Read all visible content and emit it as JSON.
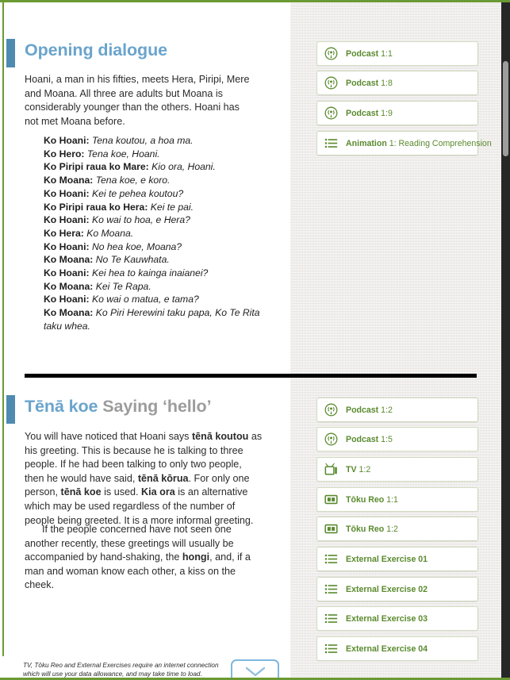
{
  "theme": {
    "accent_green": "#6a9a33",
    "link_green": "#5a8a2e",
    "heading_blue": "#6aa4cc",
    "heading_grey": "#9c9c9c",
    "tab_blue": "#4f8ab0",
    "button_border": "#cdd8bd"
  },
  "sections": [
    {
      "heading_main": "Opening dialogue",
      "heading_sub": "",
      "intro": "Hoani, a man in his fifties, meets Hera, Piripi, Mere and Moana. All three are adults but Moana is considerably younger than the others. Hoani has not met Moana before.",
      "dialogue": [
        {
          "speaker": "Ko Hoani:",
          "line": "Tena koutou, a hoa ma."
        },
        {
          "speaker": "Ko Hero:",
          "line": "Tena koe, Hoani."
        },
        {
          "speaker": "Ko Piripi raua ko Mare:",
          "line": "Kio ora, Hoani."
        },
        {
          "speaker": "Ko Moana:",
          "line": "Tena koe, e koro."
        },
        {
          "speaker": "Ko Hoani:",
          "line": "Kei te pehea koutou?"
        },
        {
          "speaker": "Ko Piripi raua ko Hera:",
          "line": "Kei te pai."
        },
        {
          "speaker": "Ko Hoani:",
          "line": "Ko wai to hoa, e Hera?"
        },
        {
          "speaker": "Ko Hera:",
          "line": "Ko Moana."
        },
        {
          "speaker": "Ko Hoani:",
          "line": "No hea koe, Moana?"
        },
        {
          "speaker": "Ko Moana:",
          "line": "No Te Kauwhata."
        },
        {
          "speaker": "Ko Hoani:",
          "line": "Kei hea to kainga inaianei?"
        },
        {
          "speaker": "Ko Moana:",
          "line": "Kei Te Rapa."
        },
        {
          "speaker": "Ko Hoani:",
          "line": "Ko wai o matua, e tama?"
        },
        {
          "speaker": "Ko Moana:",
          "line": "Ko Piri Herewini taku papa, Ko Te Rita taku whea."
        }
      ],
      "media": [
        {
          "icon": "podcast-icon",
          "label_strong": "Podcast",
          "label_rest": " 1:1"
        },
        {
          "icon": "podcast-icon",
          "label_strong": "Podcast",
          "label_rest": " 1:8"
        },
        {
          "icon": "podcast-icon",
          "label_strong": "Podcast",
          "label_rest": " 1:9"
        },
        {
          "icon": "list-icon",
          "label_strong": "Animation",
          "label_rest": " 1: Reading Comprehension"
        }
      ]
    },
    {
      "heading_main": "Tēnā koe",
      "heading_sub": " Saying ‘hello’",
      "paragraph_1_html": "You will have noticed that Hoani says <b>tēnā koutou</b> as his greeting. This is because he is talking to three people. If he had been talking to only two people, then he would have said, <b>tēnā kōrua</b>. For only one person, <b>tēnā koe</b> is used. <b>Kia ora</b> is an alternative which may be used regardless of the number of people being greeted. It is a more informal greeting.",
      "paragraph_2_html": "If the people concerned have not seen one another recently, these greetings will usually be accompanied by hand-shaking, the <b>hongi</b>, and, if a man and woman know each other, a kiss on the cheek.",
      "media": [
        {
          "icon": "podcast-icon",
          "label_strong": "Podcast",
          "label_rest": " 1:2"
        },
        {
          "icon": "podcast-icon",
          "label_strong": "Podcast",
          "label_rest": " 1:5"
        },
        {
          "icon": "tv-icon",
          "label_strong": "TV",
          "label_rest": " 1:2"
        },
        {
          "icon": "video-icon",
          "label_strong": "Tōku Reo",
          "label_rest": " 1:1"
        },
        {
          "icon": "video-icon",
          "label_strong": "Tōku Reo",
          "label_rest": " 1:2"
        },
        {
          "icon": "list-icon",
          "label_strong": "External Exercise 01",
          "label_rest": ""
        },
        {
          "icon": "list-icon",
          "label_strong": "External Exercise 02",
          "label_rest": ""
        },
        {
          "icon": "list-icon",
          "label_strong": "External Exercise 03",
          "label_rest": ""
        },
        {
          "icon": "list-icon",
          "label_strong": "External Exercise 04",
          "label_rest": ""
        }
      ]
    }
  ],
  "footer": {
    "note_line_1": "TV, Tōku Reo and External Exercises require an internet connection",
    "note_line_2": "which will use your data allowance, and may take time to load.",
    "scroll_button_icon": "chevron-down-icon"
  }
}
